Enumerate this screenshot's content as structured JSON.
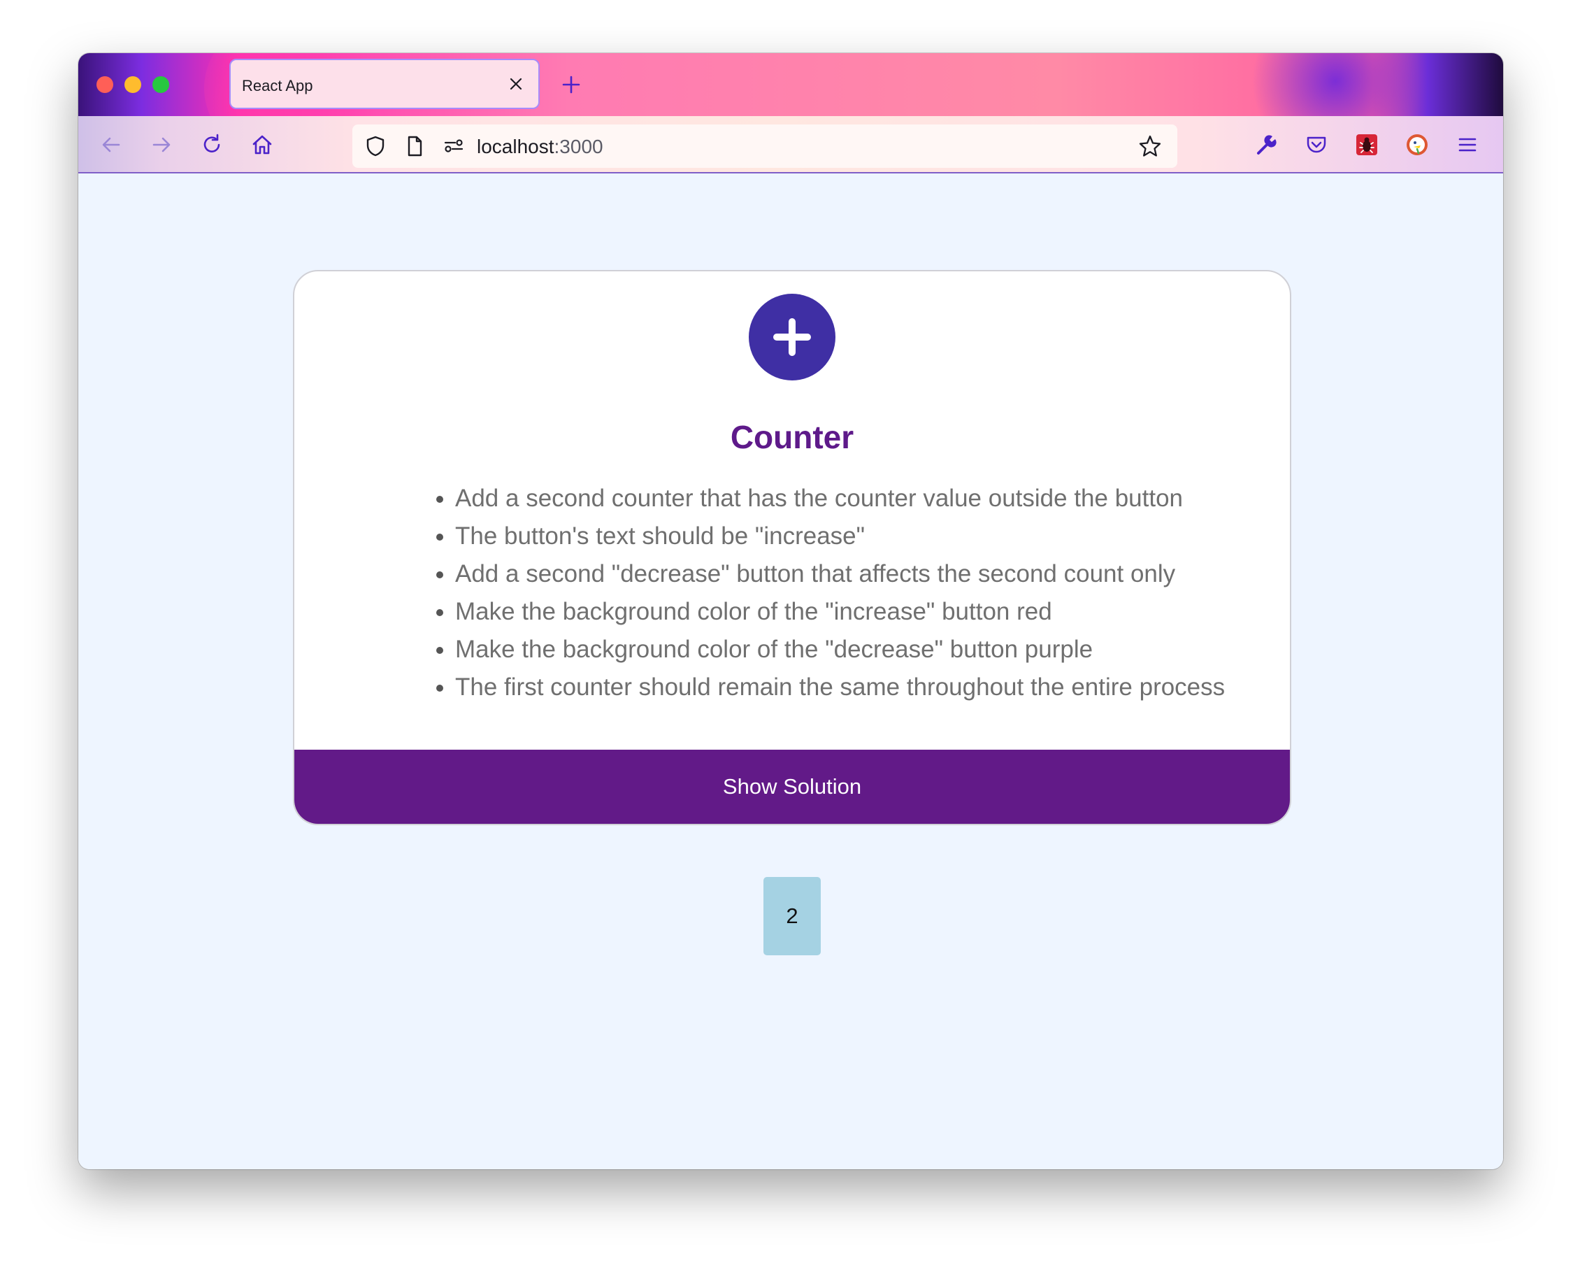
{
  "browser": {
    "tab_title": "React App",
    "url_host": "localhost",
    "url_port": ":3000"
  },
  "card": {
    "title": "Counter",
    "items": [
      "Add a second counter that has the counter value outside the button",
      "The button's text should be \"increase\"",
      "Add a second \"decrease\" button that affects the second count only",
      "Make the background color of the \"increase\" button red",
      "Make the background color of the \"decrease\" button purple",
      "The first counter should remain the same throughout the entire process"
    ],
    "solution_label": "Show Solution"
  },
  "counter": {
    "value": "2"
  },
  "colors": {
    "card_title": "#5e1a8a",
    "solution_bg": "#621a88",
    "plus_circle": "#3f2fa4",
    "counter_bg": "#a5d2e3",
    "page_bg": "#eef5ff"
  },
  "icons": {
    "toolbar_left": [
      "back-icon",
      "forward-icon",
      "reload-icon",
      "home-icon"
    ],
    "urlbar": [
      "shield-icon",
      "page-icon",
      "site-permissions-icon",
      "bookmark-star-icon"
    ],
    "toolbar_right": [
      "wrench-icon",
      "pocket-icon",
      "extension-bug-icon",
      "duckduckgo-icon",
      "menu-icon"
    ]
  }
}
